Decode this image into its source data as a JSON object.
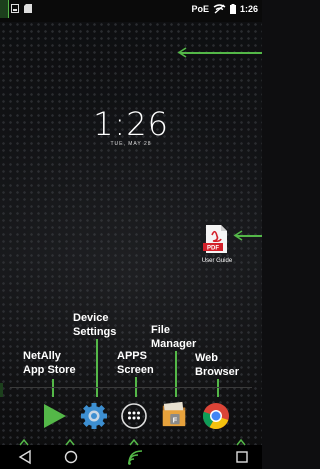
{
  "status_bar": {
    "poe_label": "PoE",
    "time": "1:26"
  },
  "lock_screen": {
    "time": "1:26",
    "date": "TUE, MAY 28"
  },
  "desktop": {
    "shortcut_label": "User Guide",
    "shortcut_icon": "pdf-file-icon",
    "shortcut_badge": "PDF"
  },
  "callouts": {
    "app_store": "NetAlly\nApp Store",
    "device_settings": "Device\nSettings",
    "apps_screen": "APPS\nScreen",
    "file_manager": "File\nManager",
    "web_browser": "Web\nBrowser"
  },
  "dock": {
    "items": [
      {
        "name": "play-store-icon"
      },
      {
        "name": "settings-gear-icon"
      },
      {
        "name": "apps-grid-icon"
      },
      {
        "name": "file-manager-icon"
      },
      {
        "name": "chrome-icon"
      }
    ]
  },
  "nav": {
    "items": [
      "back-icon",
      "home-icon",
      "netally-icon",
      "recents-icon"
    ]
  },
  "colors": {
    "accent": "#54b848",
    "background": "#0e0e10"
  }
}
